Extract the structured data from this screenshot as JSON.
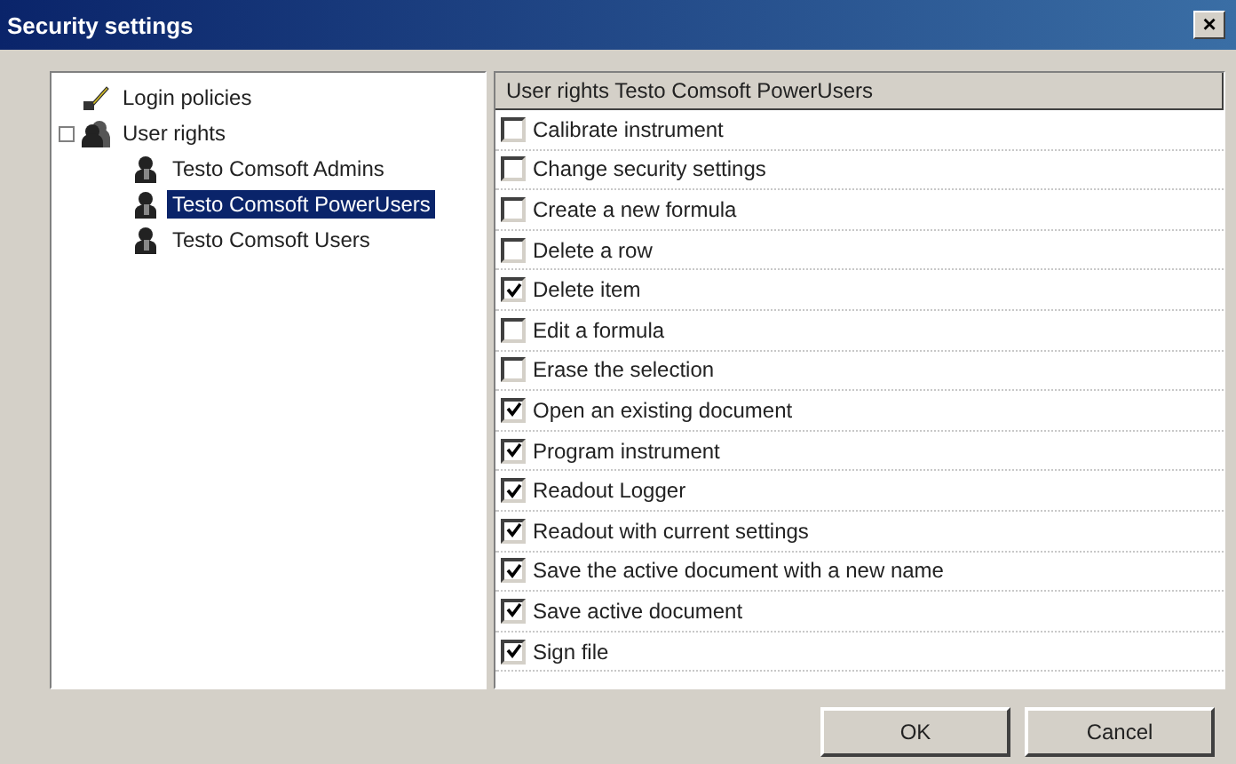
{
  "window": {
    "title": "Security settings",
    "close": "×"
  },
  "tree": [
    {
      "label": "Login policies",
      "kind": "policy",
      "selected": false
    },
    {
      "label": "User rights",
      "kind": "group",
      "expanded": true,
      "selected": false,
      "children": [
        {
          "label": "Testo Comsoft Admins",
          "kind": "user",
          "selected": false
        },
        {
          "label": "Testo Comsoft PowerUsers",
          "kind": "user",
          "selected": true
        },
        {
          "label": "Testo Comsoft Users",
          "kind": "user",
          "selected": false
        }
      ]
    }
  ],
  "rights": {
    "header": "User rights Testo Comsoft PowerUsers",
    "items": [
      {
        "label": "Calibrate instrument",
        "checked": false
      },
      {
        "label": "Change security settings",
        "checked": false
      },
      {
        "label": "Create a new formula",
        "checked": false
      },
      {
        "label": "Delete a row",
        "checked": false
      },
      {
        "label": "Delete item",
        "checked": true
      },
      {
        "label": "Edit a formula",
        "checked": false
      },
      {
        "label": "Erase the selection",
        "checked": false
      },
      {
        "label": "Open an existing document",
        "checked": true
      },
      {
        "label": "Program instrument",
        "checked": true
      },
      {
        "label": "Readout Logger",
        "checked": true
      },
      {
        "label": "Readout with current settings",
        "checked": true
      },
      {
        "label": "Save the active document with a new name",
        "checked": true
      },
      {
        "label": "Save active document",
        "checked": true
      },
      {
        "label": "Sign file",
        "checked": true
      }
    ]
  },
  "buttons": [
    "OK",
    "Cancel"
  ]
}
